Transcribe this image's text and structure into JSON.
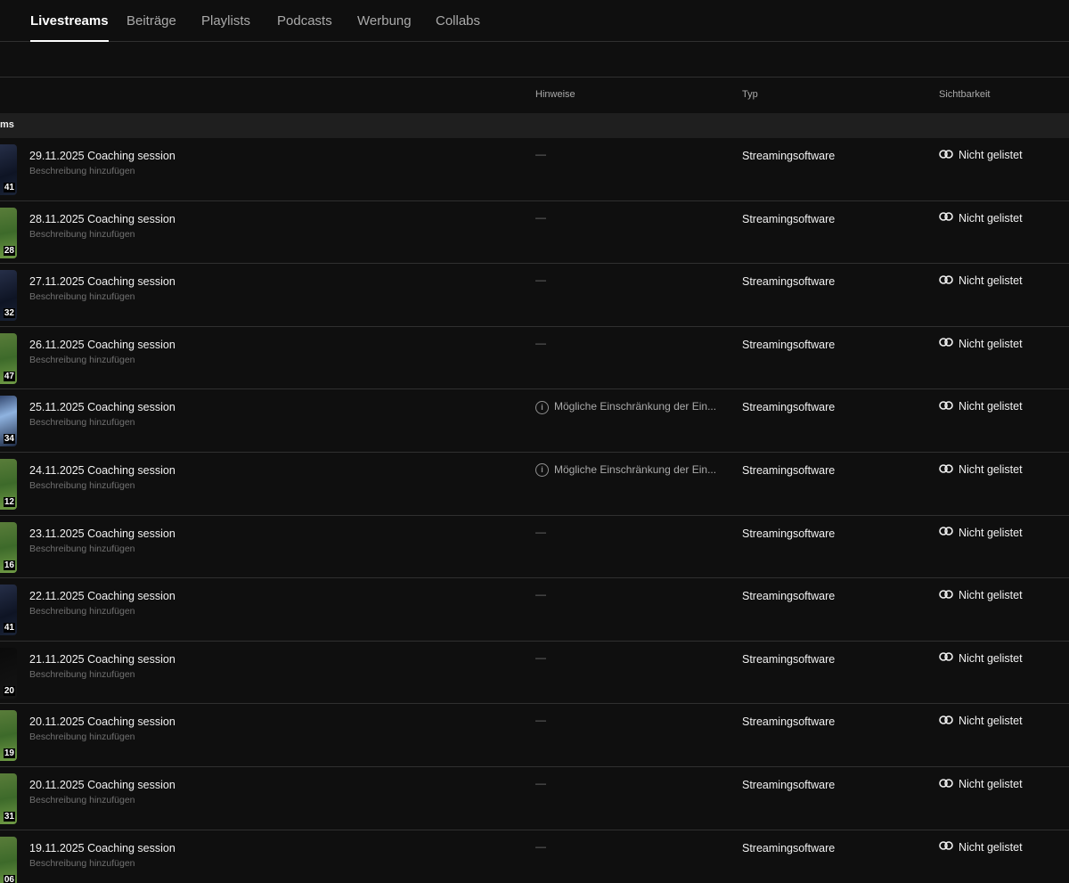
{
  "tabs": [
    {
      "label": "Livestreams",
      "active": true
    },
    {
      "label": "Beiträge"
    },
    {
      "label": "Playlists"
    },
    {
      "label": "Podcasts"
    },
    {
      "label": "Werbung"
    },
    {
      "label": "Collabs"
    }
  ],
  "columns": {
    "hinweise": "Hinweise",
    "typ": "Typ",
    "sichtbarkeit": "Sichtbarkeit"
  },
  "section_label": "ms",
  "colors": {
    "background": "#0f0f0f",
    "section_bg": "#1f1f1f",
    "divider": "#303030",
    "text_primary": "#f1f1f1",
    "text_secondary": "#aaaaaa"
  },
  "rows": [
    {
      "title": "29.11.2025 Coaching session",
      "description": "Beschreibung hinzufügen",
      "duration": "41",
      "hint": "—",
      "type": "Streamingsoftware",
      "visibility": "Nicht gelistet",
      "thumb": "dark"
    },
    {
      "title": "28.11.2025 Coaching session",
      "description": "Beschreibung hinzufügen",
      "duration": "28",
      "hint": "—",
      "type": "Streamingsoftware",
      "visibility": "Nicht gelistet",
      "thumb": "green"
    },
    {
      "title": "27.11.2025 Coaching session",
      "description": "Beschreibung hinzufügen",
      "duration": "32",
      "hint": "—",
      "type": "Streamingsoftware",
      "visibility": "Nicht gelistet",
      "thumb": "dark"
    },
    {
      "title": "26.11.2025 Coaching session",
      "description": "Beschreibung hinzufügen",
      "duration": "47",
      "hint": "—",
      "type": "Streamingsoftware",
      "visibility": "Nicht gelistet",
      "thumb": "green"
    },
    {
      "title": "25.11.2025 Coaching session",
      "description": "Beschreibung hinzufügen",
      "duration": "34",
      "hint": "Mögliche Einschränkung der Ein...",
      "hint_icon": "info-icon",
      "type": "Streamingsoftware",
      "visibility": "Nicht gelistet",
      "thumb": "blue"
    },
    {
      "title": "24.11.2025 Coaching session",
      "description": "Beschreibung hinzufügen",
      "duration": "12",
      "hint": "Mögliche Einschränkung der Ein...",
      "hint_icon": "info-icon",
      "type": "Streamingsoftware",
      "visibility": "Nicht gelistet",
      "thumb": "green"
    },
    {
      "title": "23.11.2025 Coaching session",
      "description": "Beschreibung hinzufügen",
      "duration": "16",
      "hint": "—",
      "type": "Streamingsoftware",
      "visibility": "Nicht gelistet",
      "thumb": "green"
    },
    {
      "title": "22.11.2025 Coaching session",
      "description": "Beschreibung hinzufügen",
      "duration": "41",
      "hint": "—",
      "type": "Streamingsoftware",
      "visibility": "Nicht gelistet",
      "thumb": "dark"
    },
    {
      "title": "21.11.2025 Coaching session",
      "description": "Beschreibung hinzufügen",
      "duration": "20",
      "hint": "—",
      "type": "Streamingsoftware",
      "visibility": "Nicht gelistet",
      "thumb": "black"
    },
    {
      "title": "20.11.2025 Coaching session",
      "description": "Beschreibung hinzufügen",
      "duration": "19",
      "hint": "—",
      "type": "Streamingsoftware",
      "visibility": "Nicht gelistet",
      "thumb": "green"
    },
    {
      "title": "20.11.2025 Coaching session",
      "description": "Beschreibung hinzufügen",
      "duration": "31",
      "hint": "—",
      "type": "Streamingsoftware",
      "visibility": "Nicht gelistet",
      "thumb": "green"
    },
    {
      "title": "19.11.2025 Coaching session",
      "description": "Beschreibung hinzufügen",
      "duration": "06",
      "hint": "—",
      "type": "Streamingsoftware",
      "visibility": "Nicht gelistet",
      "thumb": "green"
    }
  ]
}
